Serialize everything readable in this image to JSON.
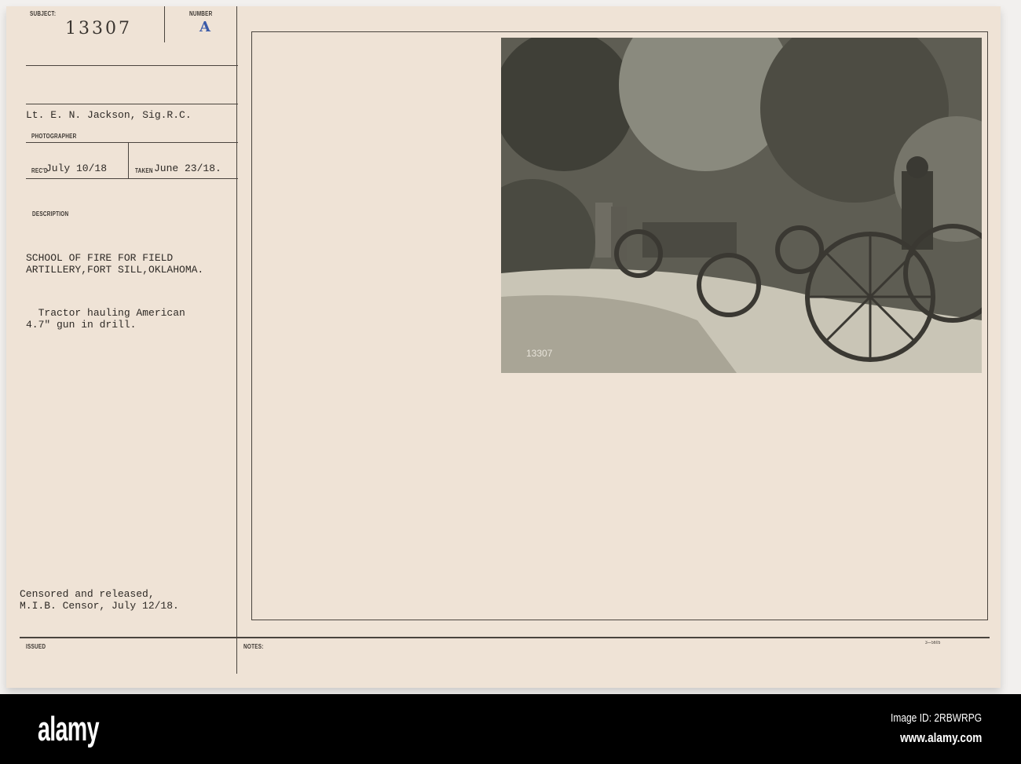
{
  "card": {
    "subject_label": "SUBJECT:",
    "subject_value": "13307",
    "number_label": "NUMBER",
    "number_value": "A",
    "photographer_name": "Lt. E. N. Jackson, Sig.R.C.",
    "photographer_label": "PHOTOGRAPHER",
    "recd_label": "REC'D",
    "recd_value": "July 10/18",
    "taken_label": "TAKEN",
    "taken_value": "June 23/18.",
    "description_label": "DESCRIPTION",
    "description_line1": "SCHOOL OF FIRE FOR FIELD",
    "description_line2": "ARTILLERY,FORT SILL,OKLAHOMA.",
    "caption_line1": "  Tractor hauling American",
    "caption_line2": "4.7\" gun in drill.",
    "censor_line1": "Censored and released,",
    "censor_line2": "M.I.B. Censor, July 12/18.",
    "issued_label": "ISSUED",
    "notes_label": "NOTES:",
    "form_number": "3—5605",
    "photo_number": "13307"
  },
  "footer": {
    "logo": "alamy",
    "image_id": "Image ID: 2RBWRPG",
    "url": "www.alamy.com"
  }
}
